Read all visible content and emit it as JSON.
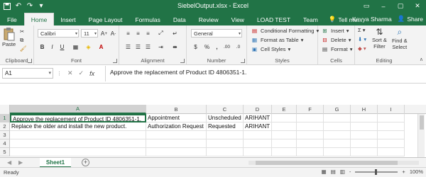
{
  "title_bar": {
    "doc_title": "SiebelOutput.xlsx - Excel",
    "icons": [
      "save-icon",
      "undo-icon",
      "redo-icon",
      "customize-qat-icon"
    ]
  },
  "tabs": [
    "File",
    "Home",
    "Insert",
    "Page Layout",
    "Formulas",
    "Data",
    "Review",
    "View",
    "LOAD TEST",
    "Team"
  ],
  "active_tab": "Home",
  "tell_me": "Tell me...",
  "user_name": "Kavya Sharma",
  "share_label": "Share",
  "ribbon": {
    "clipboard": {
      "label": "Clipboard",
      "paste": "Paste"
    },
    "font": {
      "label": "Font",
      "font_name": "Calibri",
      "font_size": "11",
      "bold": "B",
      "italic": "I",
      "underline": "U"
    },
    "alignment": {
      "label": "Alignment"
    },
    "number": {
      "label": "Number",
      "format": "General",
      "currency": "$",
      "percent": "%",
      "comma": ",",
      "inc_dec": ".00",
      "dec_dec": ".0"
    },
    "styles": {
      "label": "Styles",
      "conditional": "Conditional Formatting",
      "format_table": "Format as Table",
      "cell_styles": "Cell Styles"
    },
    "cells": {
      "label": "Cells",
      "insert": "Insert",
      "delete": "Delete",
      "format": "Format"
    },
    "editing": {
      "label": "Editing",
      "sort_filter": "Sort &",
      "sort_filter2": "Filter",
      "find_select": "Find &",
      "find_select2": "Select"
    }
  },
  "formula_bar": {
    "name_box": "A1",
    "cancel": "✕",
    "enter": "✓",
    "fx": "fx",
    "content": "Approve the replacement of Product ID 4806351-1."
  },
  "columns": [
    "A",
    "B",
    "C",
    "D",
    "E",
    "F",
    "G",
    "H",
    "I"
  ],
  "rows": [
    "1",
    "2",
    "3",
    "4",
    "5"
  ],
  "cells": [
    [
      "Approve the replacement of Product ID 4806351-1.",
      "Appointment",
      "Unscheduled",
      "ARIHANT",
      "",
      "",
      "",
      "",
      ""
    ],
    [
      "Replace the older and install the new product.",
      "Authorization Request",
      "Requested",
      "ARIHANT",
      "",
      "",
      "",
      "",
      ""
    ],
    [
      "",
      "",
      "",
      "",
      "",
      "",
      "",
      "",
      ""
    ],
    [
      "",
      "",
      "",
      "",
      "",
      "",
      "",
      "",
      ""
    ],
    [
      "",
      "",
      "",
      "",
      "",
      "",
      "",
      "",
      ""
    ]
  ],
  "sheet_tab": "Sheet1",
  "status": {
    "ready": "Ready",
    "zoom": "100%",
    "zoom_minus": "-",
    "zoom_plus": "+"
  },
  "accent_color": "#217346"
}
